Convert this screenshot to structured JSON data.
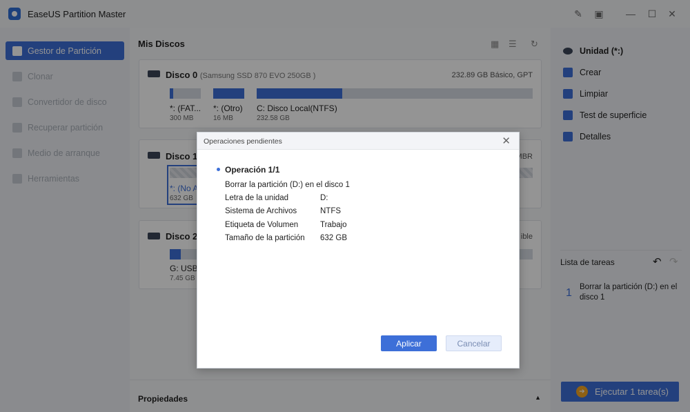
{
  "window": {
    "title": "EaseUS Partition Master"
  },
  "sidebar": {
    "items": [
      {
        "label": "Gestor de Partición",
        "active": true
      },
      {
        "label": "Clonar"
      },
      {
        "label": "Convertidor de disco"
      },
      {
        "label": "Recuperar partición"
      },
      {
        "label": "Medio de arranque"
      },
      {
        "label": "Herramientas"
      }
    ]
  },
  "main": {
    "title": "Mis Discos",
    "disks": [
      {
        "name": "Disco 0",
        "model": "(Samsung SSD 870 EVO 250GB )",
        "info": "232.89 GB Básico, GPT",
        "partitions": [
          {
            "label": "*: (FAT...",
            "size": "300 MB",
            "fill": 0.12
          },
          {
            "label": "*: (Otro)",
            "size": "16 MB",
            "fill": 1.0
          },
          {
            "label": "C: Disco Local(NTFS)",
            "size": "232.58 GB",
            "fill": 0.31
          }
        ]
      },
      {
        "name": "Disco 1",
        "info_partial": "MBR",
        "partitions": [
          {
            "label": "*: (No A",
            "size": "632 GB"
          }
        ]
      },
      {
        "name": "Disco 2",
        "info_partial": "ible",
        "partitions": [
          {
            "label": "G: USB(",
            "size": "7.45 GB",
            "fill": 0.35
          }
        ]
      }
    ],
    "properties_label": "Propiedades"
  },
  "right_panel": {
    "unit_label": "Unidad (*:)",
    "actions": [
      {
        "label": "Crear",
        "icon": "create-icon"
      },
      {
        "label": "Limpiar",
        "icon": "eraser-icon"
      },
      {
        "label": "Test de superficie",
        "icon": "surface-test-icon"
      },
      {
        "label": "Detalles",
        "icon": "details-icon"
      }
    ],
    "tasks_title": "Lista de tareas",
    "task": {
      "number": "1",
      "text": "Borrar la partición (D:) en el disco 1"
    },
    "run_button": "Ejecutar 1 tarea(s)"
  },
  "dialog": {
    "title": "Operaciones pendientes",
    "operation_title": "Operación 1/1",
    "operation_desc": "Borrar la partición (D:) en el disco 1",
    "details": [
      {
        "key": "Letra de la unidad",
        "value": "D:"
      },
      {
        "key": "Sistema de Archivos",
        "value": "NTFS"
      },
      {
        "key": "Etiqueta de Volumen",
        "value": "Trabajo"
      },
      {
        "key": "Tamaño de la partición",
        "value": "632 GB"
      }
    ],
    "apply": "Aplicar",
    "cancel": "Cancelar"
  },
  "colors": {
    "accent": "#3d6fd8",
    "run_icon": "#f5a623"
  }
}
